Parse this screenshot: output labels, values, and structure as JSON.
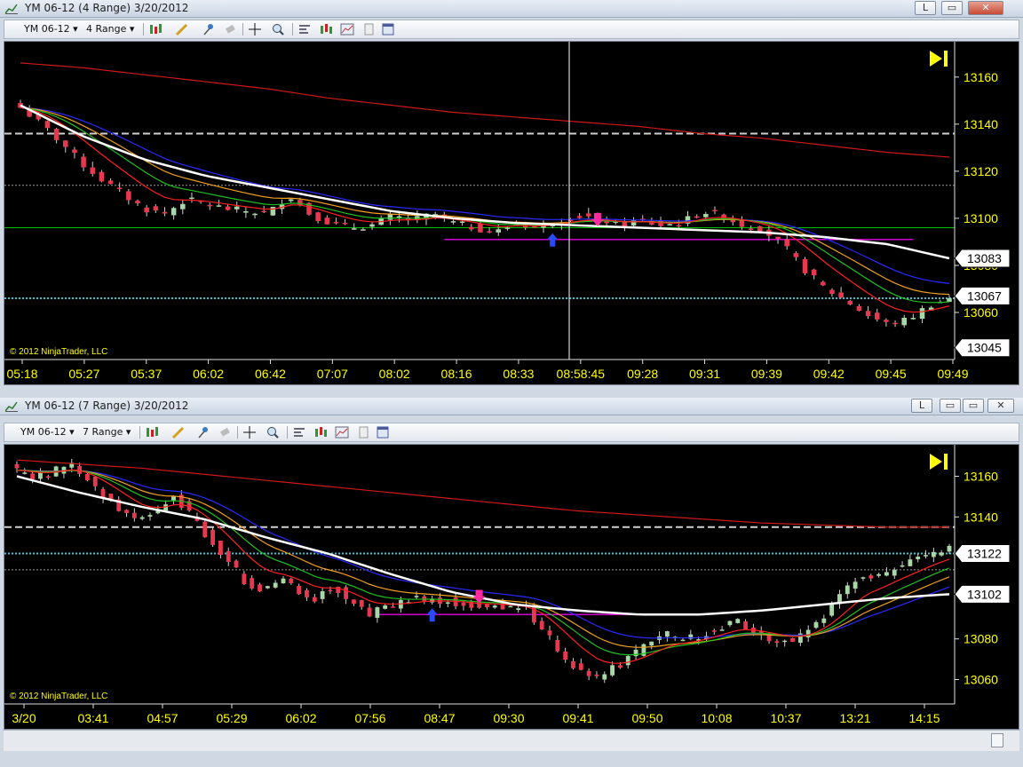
{
  "colors": {
    "background": "#000000",
    "axis_text": "#ffff00",
    "bull_candle": "#a8d8a8",
    "bear_candle": "#e8384f",
    "sma_white": "#ffffff",
    "ema_red_slow": "#d01818",
    "ema_blue": "#2a2aff",
    "ema_orange": "#f0a020",
    "ema_green": "#20c020",
    "ema_red_fast": "#ff2020",
    "line_green": "#00c000",
    "line_cyan": "#30c8d8",
    "line_dashed_white": "#d0d0d0",
    "line_magenta": "#d000d0",
    "crosshair": "#ffffff",
    "label_box": "#ffffff"
  },
  "charts": [
    {
      "title": "YM 06-12 (4 Range)  3/20/2012",
      "controls": {
        "minimize": "L",
        "restore": "▭",
        "close": "✕"
      },
      "toolbar": {
        "instrument": "YM 06-12",
        "period": "4 Range"
      },
      "copyright": "© 2012 NinjaTrader, LLC",
      "play_icon": "skip-end-icon",
      "y_ticks": [
        "13160",
        "13140",
        "13120",
        "13100",
        "13080",
        "13060"
      ],
      "price_labels": [
        "13083",
        "13067",
        "13045"
      ],
      "x_ticks": [
        "05:18",
        "05:27",
        "05:37",
        "06:02",
        "06:42",
        "07:07",
        "08:02",
        "08:16",
        "08:33",
        "08:58:45",
        "09:28",
        "09:31",
        "09:39",
        "09:42",
        "09:45",
        "09:49"
      ],
      "icons": [
        "chart-style-icon",
        "pencil-icon",
        "pin-icon",
        "eraser-icon",
        "crosshair-icon",
        "zoom-icon",
        "indicators-icon",
        "strategies-icon",
        "chart-properties-icon",
        "page-icon",
        "window-icon"
      ]
    },
    {
      "title": "YM 06-12 (7 Range)  3/20/2012",
      "controls": {
        "minimize": "L",
        "restore": "▭",
        "close": "✕"
      },
      "toolbar": {
        "instrument": "YM 06-12",
        "period": "7 Range"
      },
      "copyright": "© 2012 NinjaTrader, LLC",
      "play_icon": "skip-end-icon",
      "y_ticks": [
        "13160",
        "13140",
        "13080",
        "13060"
      ],
      "price_labels": [
        "13122",
        "13102"
      ],
      "x_ticks": [
        "3/20",
        "03:41",
        "04:57",
        "05:29",
        "06:02",
        "07:56",
        "08:47",
        "09:30",
        "09:41",
        "09:50",
        "10:08",
        "10:37",
        "13:21",
        "14:15"
      ],
      "icons": [
        "chart-style-icon",
        "pencil-icon",
        "pin-icon",
        "eraser-icon",
        "crosshair-icon",
        "zoom-icon",
        "indicators-icon",
        "strategies-icon",
        "chart-properties-icon",
        "page-icon",
        "window-icon"
      ]
    }
  ],
  "chart_data": [
    {
      "type": "candlestick",
      "instrument": "YM 06-12",
      "period": "4 Range",
      "date": "3/20/2012",
      "ylim": [
        13040,
        13172
      ],
      "x": [
        "05:18",
        "05:27",
        "05:37",
        "06:02",
        "06:42",
        "07:07",
        "08:02",
        "08:16",
        "08:33",
        "08:58:45",
        "09:28",
        "09:31",
        "09:39",
        "09:42",
        "09:45",
        "09:49"
      ],
      "close_path": [
        13147,
        13140,
        13132,
        13123,
        13116,
        13110,
        13104,
        13102,
        13108,
        13106,
        13104,
        13103,
        13102,
        13110,
        13102,
        13098,
        13096,
        13097,
        13101,
        13099,
        13102,
        13098,
        13096,
        13094,
        13098,
        13096,
        13099,
        13101,
        13100,
        13097,
        13099,
        13097,
        13098,
        13103,
        13101,
        13097,
        13095,
        13088,
        13078,
        13070,
        13065,
        13059,
        13055,
        13057,
        13063,
        13066
      ],
      "overlays": {
        "sma_white": [
          13148,
          13135,
          13125,
          13118,
          13113,
          13108,
          13103,
          13100,
          13098,
          13097,
          13096,
          13095,
          13094,
          13092,
          13089,
          13083
        ],
        "ema_red_slow": [
          13166,
          13164,
          13161,
          13158,
          13155,
          13151,
          13148,
          13145,
          13143,
          13141,
          13139,
          13136,
          13134,
          13131,
          13128,
          13126
        ]
      },
      "levels": {
        "dashed_white": 13136,
        "dotted_grey": 13114,
        "solid_green": 13096,
        "dotted_cyan": 13066,
        "magenta_line": 13091
      },
      "last_prices": {
        "white_sma": 13083,
        "cyan_line": 13067,
        "current": 13045
      },
      "crosshair_time": "08:58:45"
    },
    {
      "type": "candlestick",
      "instrument": "YM 06-12",
      "period": "7 Range",
      "date": "3/20/2012",
      "ylim": [
        13048,
        13172
      ],
      "x": [
        "3/20",
        "03:41",
        "04:57",
        "05:29",
        "06:02",
        "07:56",
        "08:47",
        "09:30",
        "09:41",
        "09:50",
        "10:08",
        "10:37",
        "13:21",
        "14:15"
      ],
      "close_path": [
        13163,
        13160,
        13162,
        13166,
        13158,
        13150,
        13143,
        13138,
        13143,
        13150,
        13140,
        13128,
        13118,
        13108,
        13104,
        13110,
        13104,
        13100,
        13106,
        13098,
        13092,
        13096,
        13098,
        13100,
        13099,
        13098,
        13096,
        13097,
        13096,
        13094,
        13084,
        13072,
        13064,
        13061,
        13066,
        13072,
        13078,
        13082,
        13080,
        13082,
        13086,
        13088,
        13083,
        13080,
        13079,
        13084,
        13093,
        13104,
        13112,
        13110,
        13115,
        13118,
        13122,
        13124
      ],
      "overlays": {
        "sma_white": [
          13160,
          13152,
          13145,
          13139,
          13130,
          13122,
          13112,
          13103,
          13097,
          13094,
          13092,
          13092,
          13094,
          13097,
          13100,
          13102
        ],
        "ema_red_slow": [
          13168,
          13166,
          13164,
          13161,
          13158,
          13155,
          13152,
          13149,
          13146,
          13143,
          13141,
          13139,
          13137,
          13136,
          13135,
          13135
        ]
      },
      "levels": {
        "dashed_white": 13135,
        "dotted_cyan": 13122,
        "dotted_grey": 13114,
        "magenta_line": 13092
      },
      "last_prices": {
        "cyan_line": 13122,
        "white_sma": 13102
      }
    }
  ]
}
